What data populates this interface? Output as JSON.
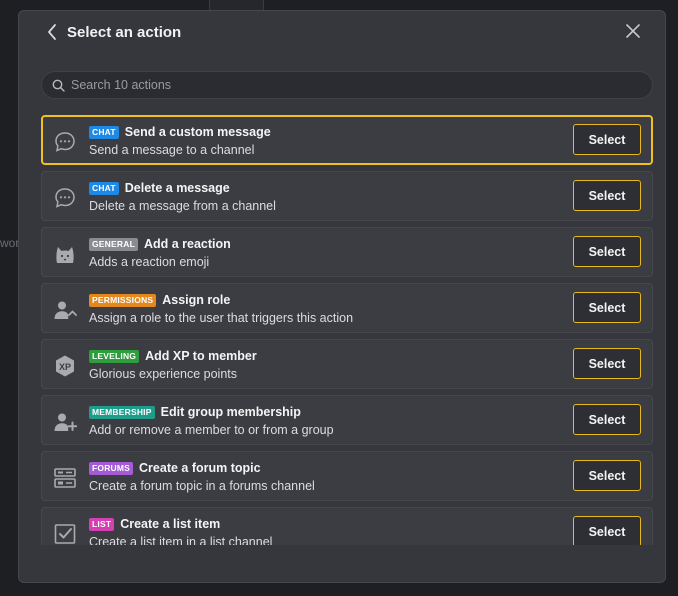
{
  "background": {
    "partial_text": "wor"
  },
  "dialog": {
    "title": "Select an action",
    "back_icon": "chevron-left-icon",
    "close_icon": "close-icon"
  },
  "search": {
    "placeholder": "Search 10 actions",
    "value": ""
  },
  "actions": [
    {
      "icon": "chat-bubble-icon",
      "category": "CHAT",
      "category_color": "#1e88e5",
      "name": "Send a custom message",
      "description": "Send a message to a channel",
      "button": "Select",
      "selected": true
    },
    {
      "icon": "chat-bubble-icon",
      "category": "CHAT",
      "category_color": "#1e88e5",
      "name": "Delete a message",
      "description": "Delete a message from a channel",
      "button": "Select",
      "selected": false
    },
    {
      "icon": "cat-emoji-icon",
      "category": "GENERAL",
      "category_color": "#8a8b90",
      "name": "Add a reaction",
      "description": "Adds a reaction emoji",
      "button": "Select",
      "selected": false
    },
    {
      "icon": "user-role-icon",
      "category": "PERMISSIONS",
      "category_color": "#e3881e",
      "name": "Assign role",
      "description": "Assign a role to the user that triggers this action",
      "button": "Select",
      "selected": false
    },
    {
      "icon": "xp-badge-icon",
      "category": "LEVELING",
      "category_color": "#2e9d3e",
      "name": "Add XP to member",
      "description": "Glorious experience points",
      "button": "Select",
      "selected": false
    },
    {
      "icon": "user-add-icon",
      "category": "MEMBERSHIP",
      "category_color": "#1f9d8a",
      "name": "Edit group membership",
      "description": "Add or remove a member to or from a group",
      "button": "Select",
      "selected": false
    },
    {
      "icon": "forum-icon",
      "category": "FORUMS",
      "category_color": "#a55bd6",
      "name": "Create a forum topic",
      "description": "Create a forum topic in a forums channel",
      "button": "Select",
      "selected": false
    },
    {
      "icon": "checkbox-list-icon",
      "category": "LIST",
      "category_color": "#d43fb4",
      "name": "Create a list item",
      "description": "Create a list item in a list channel",
      "button": "Select",
      "selected": false
    }
  ]
}
